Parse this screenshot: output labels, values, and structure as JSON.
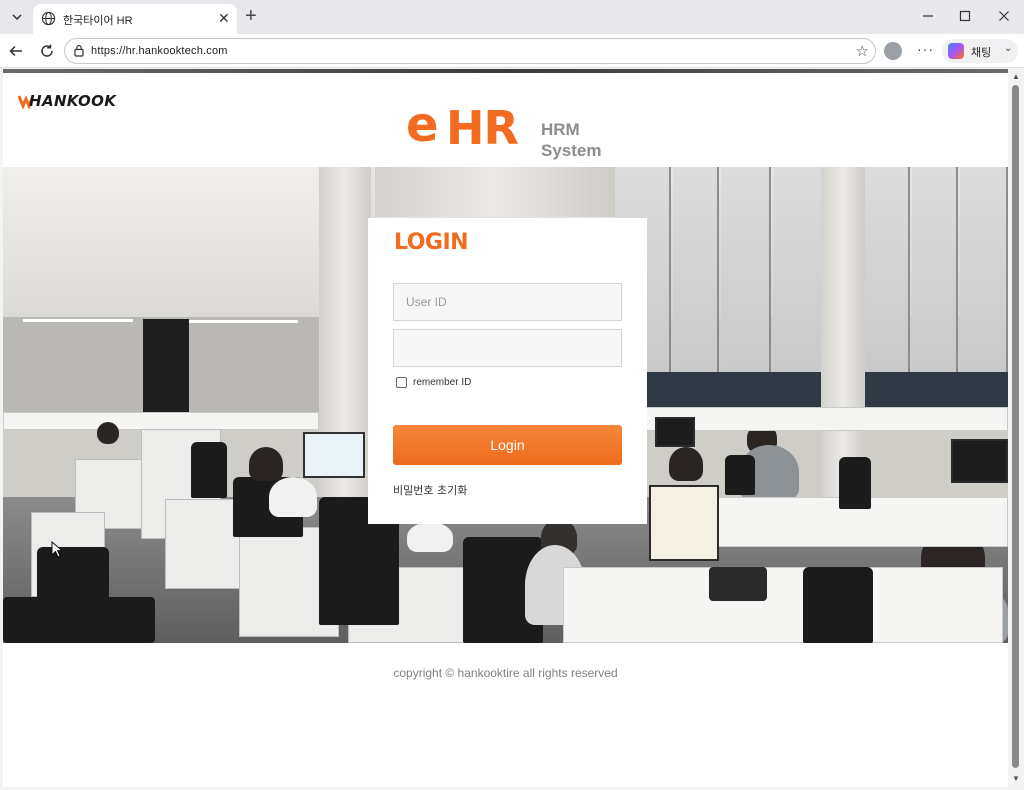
{
  "browser": {
    "tab": {
      "title": "한국타이어 HR",
      "icon": "globe-icon"
    },
    "address": {
      "url": "https://hr.hankooktech.com"
    },
    "copilot_label": "채팅"
  },
  "page": {
    "brand": "HANKOOK",
    "logo": {
      "e": "e",
      "hr": "HR",
      "sub_line1": "HRM",
      "sub_line2": "System"
    },
    "login": {
      "title": "LOGIN",
      "user_id_placeholder": "User ID",
      "password_placeholder": "",
      "remember_label": "remember ID",
      "button_label": "Login",
      "reset_link": "비밀번호 초기화"
    },
    "copyright": "copyright © hankooktire all rights reserved"
  },
  "colors": {
    "accent": "#f26b21",
    "button": "#ef7328",
    "subtext": "#8c8c8c"
  }
}
